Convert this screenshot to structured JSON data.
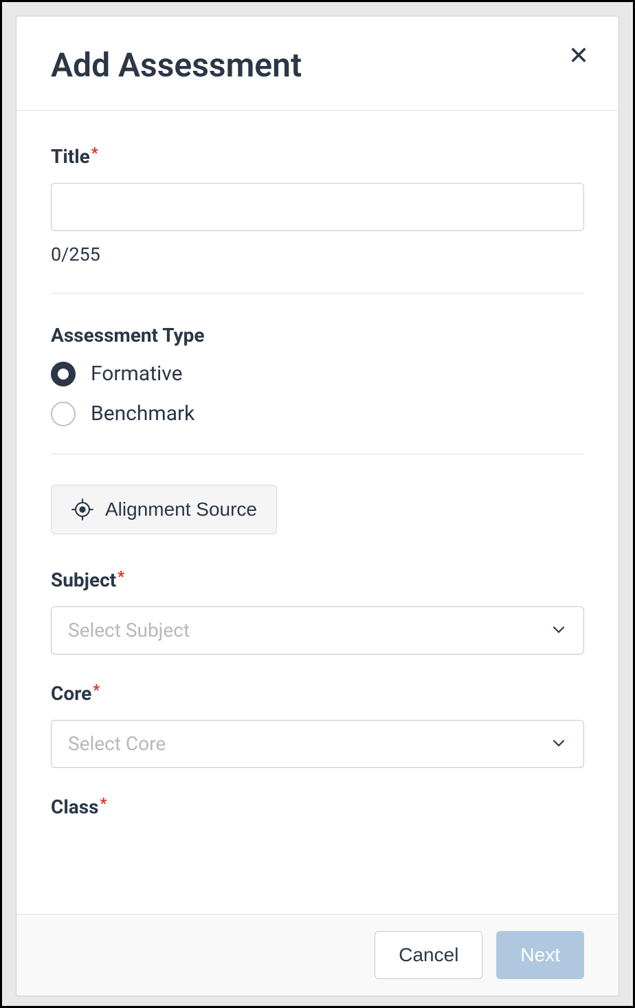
{
  "modal": {
    "title": "Add Assessment"
  },
  "fields": {
    "title": {
      "label": "Title",
      "value": "",
      "charCount": "0/255"
    },
    "assessmentType": {
      "label": "Assessment Type",
      "options": [
        {
          "label": "Formative",
          "selected": true
        },
        {
          "label": "Benchmark",
          "selected": false
        }
      ]
    },
    "alignmentSource": {
      "label": "Alignment Source"
    },
    "subject": {
      "label": "Subject",
      "placeholder": "Select Subject"
    },
    "core": {
      "label": "Core",
      "placeholder": "Select Core"
    },
    "class": {
      "label": "Class"
    }
  },
  "footer": {
    "cancel": "Cancel",
    "next": "Next"
  },
  "required": "*"
}
